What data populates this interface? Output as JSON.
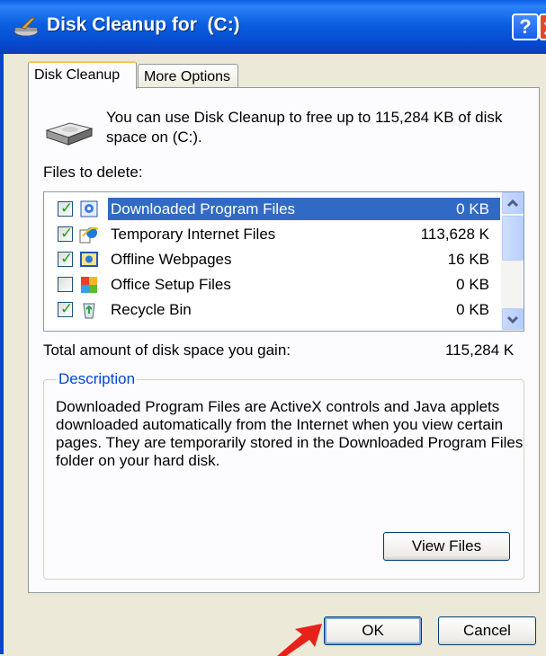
{
  "window": {
    "title": "Disk Cleanup for  (C:)",
    "help_glyph": "?"
  },
  "tabs": [
    {
      "label": "Disk Cleanup",
      "active": true
    },
    {
      "label": "More Options",
      "active": false
    }
  ],
  "intro_text": "You can use Disk Cleanup to free up to 115,284 KB of disk space on  (C:).",
  "files_label": "Files to delete:",
  "files": [
    {
      "name": "Downloaded Program Files",
      "size": "0 KB",
      "checked": true,
      "selected": true,
      "icon": "activex-icon"
    },
    {
      "name": "Temporary Internet Files",
      "size": "113,628 K",
      "checked": true,
      "selected": false,
      "icon": "ie-icon"
    },
    {
      "name": "Offline Webpages",
      "size": "16 KB",
      "checked": true,
      "selected": false,
      "icon": "offline-webpages-icon"
    },
    {
      "name": "Office Setup Files",
      "size": "0 KB",
      "checked": false,
      "selected": false,
      "icon": "office-icon"
    },
    {
      "name": "Recycle Bin",
      "size": "0 KB",
      "checked": true,
      "selected": false,
      "icon": "recycle-bin-icon"
    }
  ],
  "total_label": "Total amount of disk space you gain:",
  "total_value": "115,284 K",
  "description": {
    "legend": "Description",
    "text": "Downloaded Program Files are ActiveX controls and Java applets downloaded automatically from the Internet when you view certain pages. They are temporarily stored in the Downloaded Program Files folder on your hard disk."
  },
  "buttons": {
    "view_files": "View Files",
    "ok": "OK",
    "cancel": "Cancel"
  },
  "colors": {
    "titlebar": "#0a5fe0",
    "selection": "#316ac5",
    "arrow": "#e8211a"
  }
}
